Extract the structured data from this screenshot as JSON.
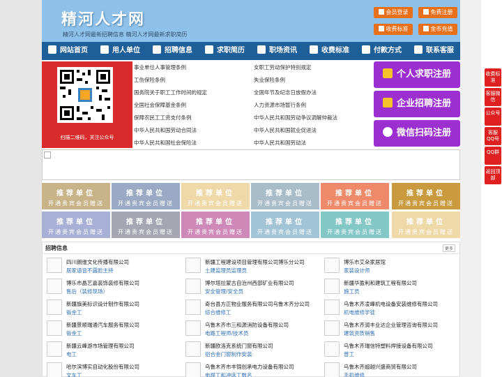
{
  "header": {
    "title": "精河人才网",
    "subtitle": "精河人才网最新招聘信息   精河人才网最新求职简历",
    "buttons": {
      "login": "会员登录",
      "register": "免费注册",
      "pricing": "收费标准",
      "recharge": "金币充值"
    }
  },
  "nav": [
    "网站首页",
    "用人单位",
    "招聘信息",
    "求职简历",
    "职场资讯",
    "收费标准",
    "付款方式",
    "联系客服"
  ],
  "qr": {
    "caption": "扫描二维码，关注公众号"
  },
  "news_left": [
    "事业单位人事管理条例",
    "工伤保险条例",
    "国务院关于职工工作时间的规定",
    "全国社会保障基金条例",
    "保障农民工工资支付条例",
    "中华人民共和国劳动合同法",
    "中华人民共和国社会保险法"
  ],
  "news_right": [
    "女职工劳动保护特别规定",
    "失业保险条例",
    "全国年节及纪念日放假办法",
    "人力资源市场暂行条例",
    "中华人民共和国劳动争议调解仲裁法",
    "中华人民共和国就业促进法",
    "中华人民共和国劳动法"
  ],
  "register": {
    "personal": "个人求职注册",
    "company": "企业招聘注册",
    "wechat": "微信扫码注册"
  },
  "ads": {
    "line1": "推荐单位",
    "line2": "开通贵宾会员赠送",
    "colors": [
      "#c9b48a",
      "#9aaac4",
      "#efd9a8",
      "#a9bcc9",
      "#ee8a6a",
      "#c99a3e",
      "#a9b0d6",
      "#a6a6b3",
      "#cf89b9",
      "#a2c4d6",
      "#83c7c7",
      "#efd9a8"
    ]
  },
  "jobs": {
    "title": "招聘信息",
    "more": "更多",
    "col1": [
      {
        "company": "四川朗维文化传播有限公司",
        "position": "居家语音不露脸主持"
      },
      {
        "company": "博乐市晶艺嘉装饰装修有限公司",
        "position": "售后（装修现场）"
      },
      {
        "company": "新疆旗美标识设计制作有限公司",
        "position": "钣金工"
      },
      {
        "company": "新疆景顺瑞通汽车服务有限公司",
        "position": "钣金工"
      },
      {
        "company": "新疆云峰游市场管理有限公司",
        "position": "电工"
      },
      {
        "company": "哈尔滨博实自动化股份有限公司",
        "position": "文车工"
      }
    ],
    "col2": [
      {
        "company": "新疆工程建设项目管理有限公司博乐分公司",
        "position": "土建监理员监理员"
      },
      {
        "company": "博尔塔拉蒙古自治州西部矿业有限公司",
        "position": "安全管理/安全员"
      },
      {
        "company": "奇台县方正物业服务有限公司乌鲁木齐分公司",
        "position": "综合维修工"
      },
      {
        "company": "乌鲁木齐市三和源消防设备有限公司",
        "position": "电路工程师/技术员"
      },
      {
        "company": "新疆欧洛克系统门窗有限公司",
        "position": "铝合金门窗制作安装"
      },
      {
        "company": "乌鲁木齐市丰锦创承电力设备有限公司",
        "position": "电焊工和冲床工数名"
      }
    ],
    "col3": [
      {
        "company": "博乐市艾朵家居馆",
        "position": "家装设计师"
      },
      {
        "company": "新疆华盈利和建筑工程有限公司",
        "position": "施工员"
      },
      {
        "company": "乌鲁木齐凌峰机电设备安装维修有限公司",
        "position": "机电维修学徒"
      },
      {
        "company": "乌鲁木齐润丰业达企业管理咨询有限公司",
        "position": "建筑资质销售"
      },
      {
        "company": "乌鲁木齐瑞信特塑料焊接设备有限公司",
        "position": "普工"
      },
      {
        "company": "乌鲁木齐超越兴盛商贸有限公司",
        "position": "手机维修"
      }
    ]
  },
  "float": [
    "收费标准",
    "客服微信",
    "公众号",
    "客服QQ号",
    "QQ群",
    "返回顶部"
  ]
}
